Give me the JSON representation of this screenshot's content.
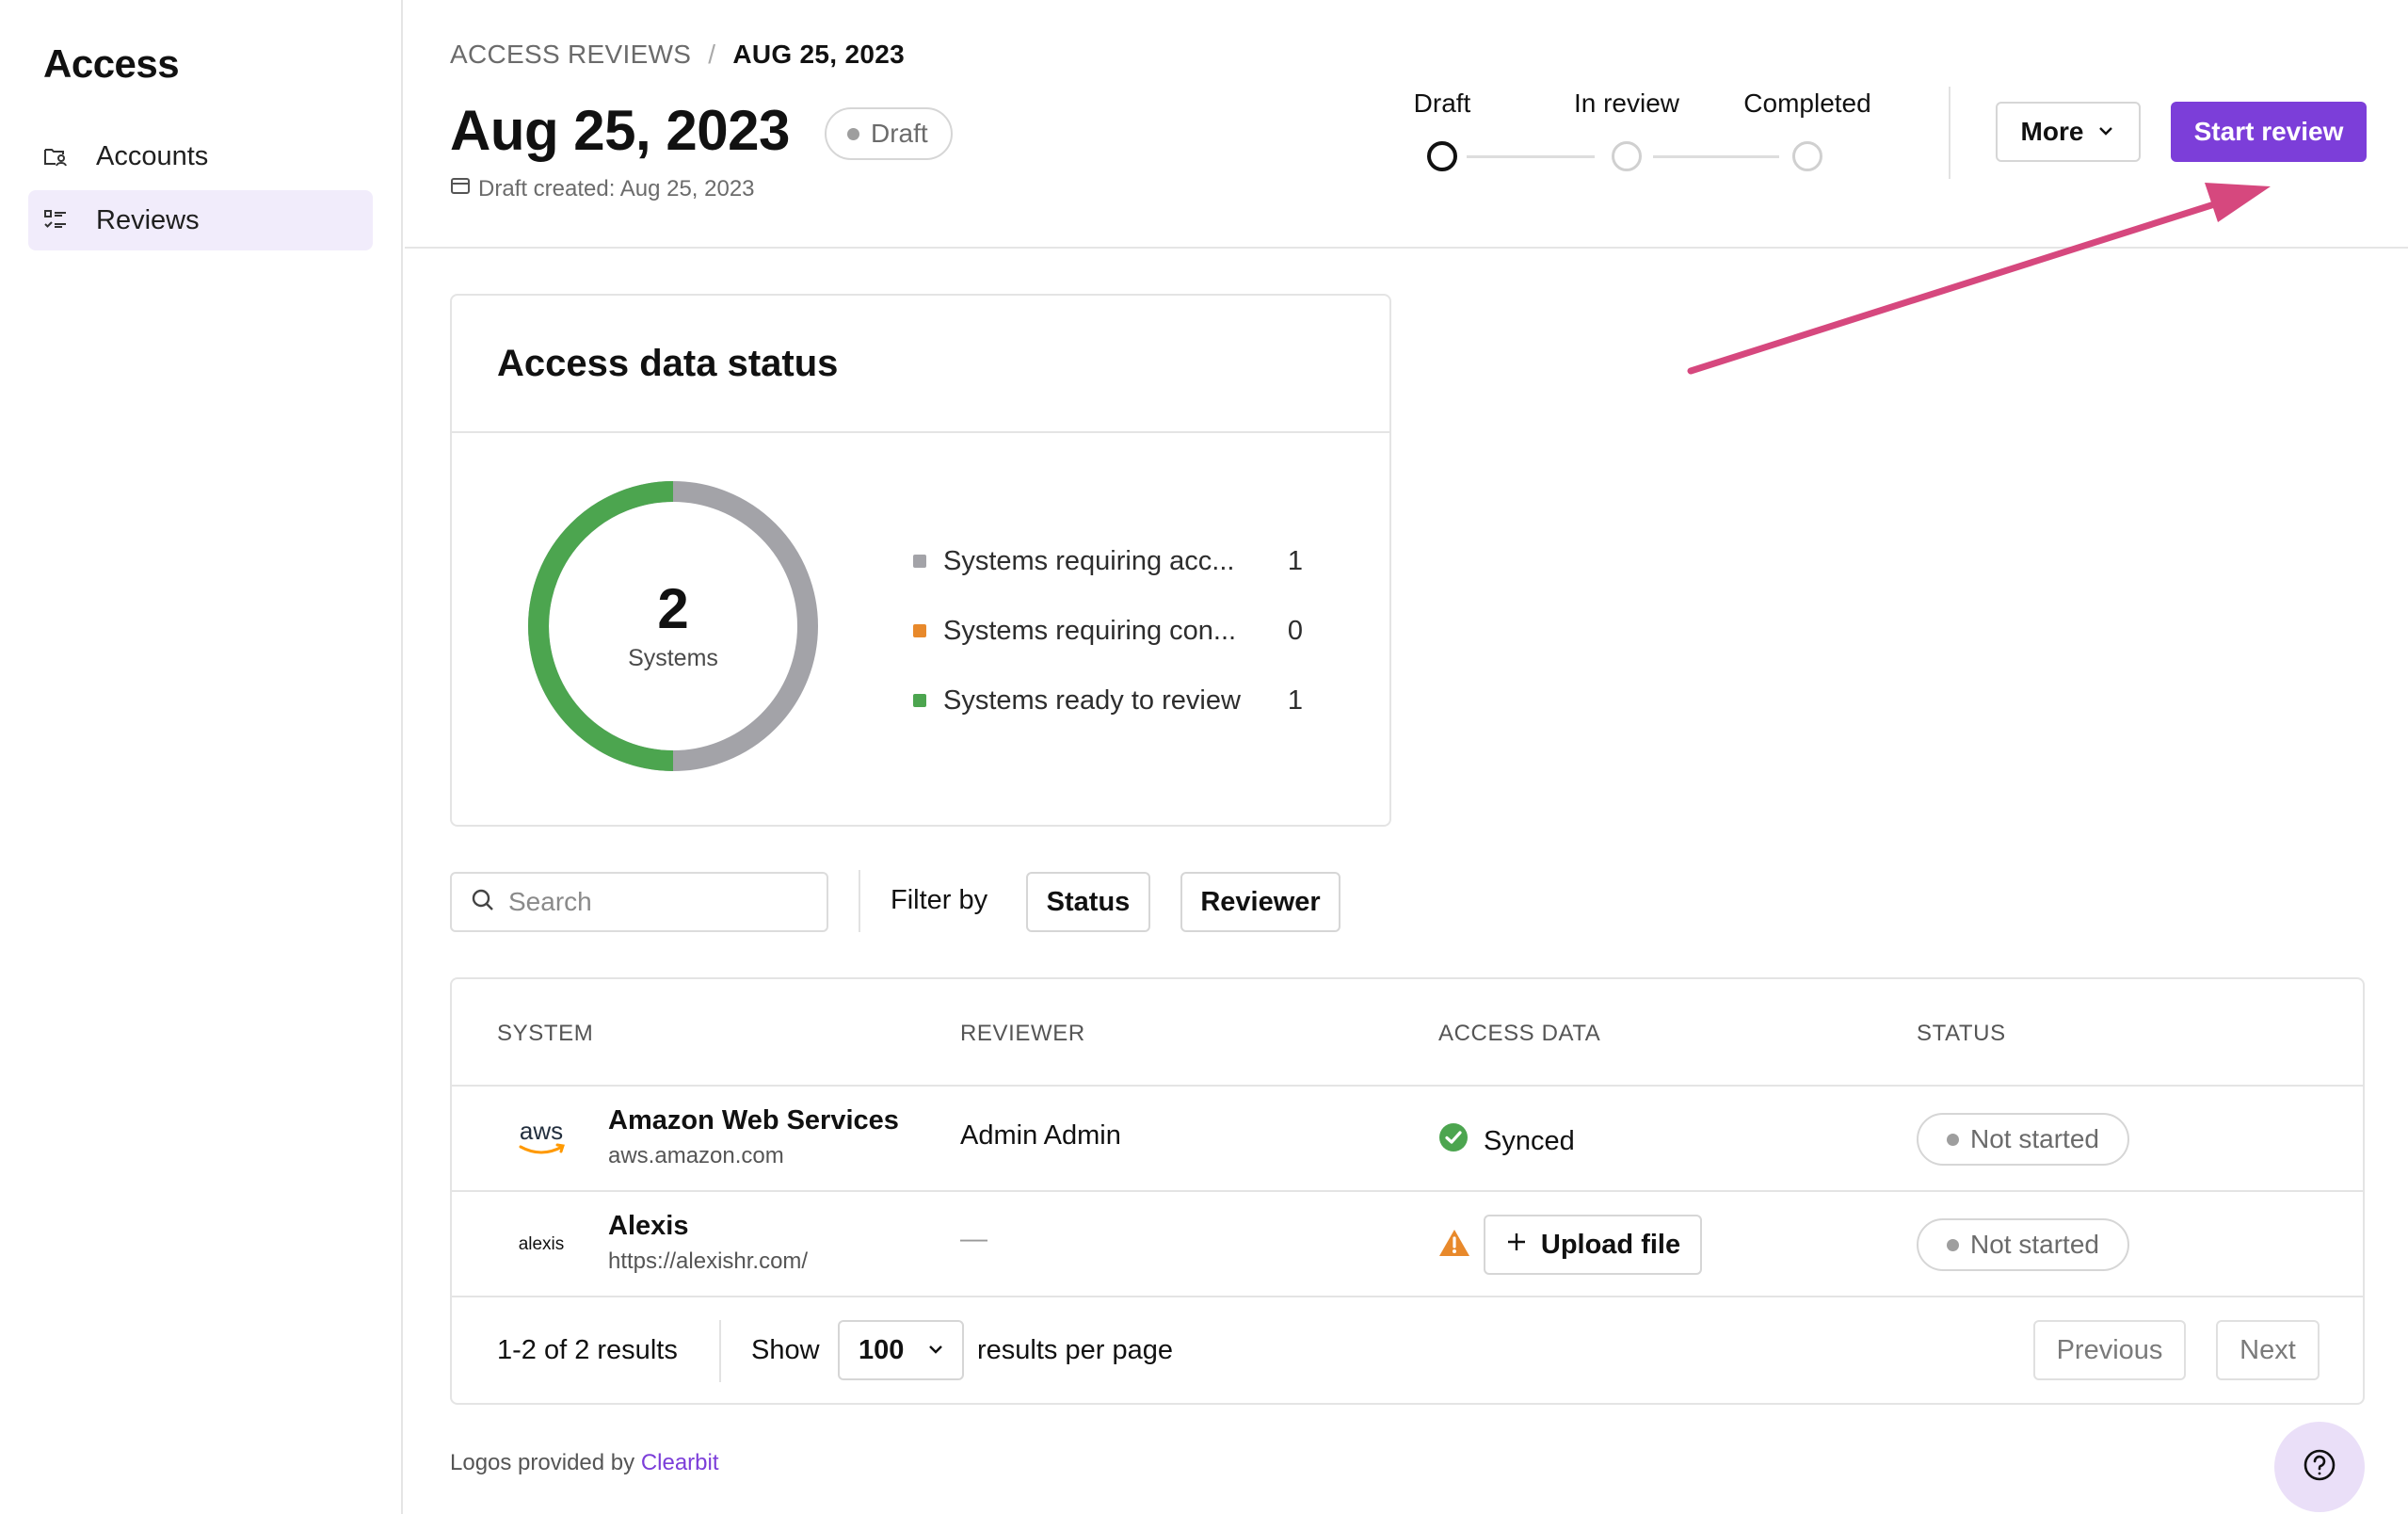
{
  "sidebar": {
    "app_title": "Access",
    "items": [
      {
        "label": "Accounts",
        "icon": "folder-user-icon",
        "active": false
      },
      {
        "label": "Reviews",
        "icon": "checklist-icon",
        "active": true
      }
    ]
  },
  "header": {
    "breadcrumb": {
      "parent": "ACCESS REVIEWS",
      "separator": "/",
      "current": "AUG 25, 2023"
    },
    "title": "Aug 25, 2023",
    "badge": "Draft",
    "draft_created": "Draft created: Aug 25, 2023",
    "stepper": {
      "steps": [
        {
          "label": "Draft",
          "state": "current"
        },
        {
          "label": "In review",
          "state": "todo"
        },
        {
          "label": "Completed",
          "state": "todo"
        }
      ]
    },
    "more_label": "More",
    "start_label": "Start review"
  },
  "status_card": {
    "title": "Access data status",
    "total": "2",
    "total_label": "Systems",
    "legend": [
      {
        "label": "Systems requiring acc...",
        "value": "1",
        "color": "#a3a3a8"
      },
      {
        "label": "Systems requiring con...",
        "value": "0",
        "color": "#e8892b"
      },
      {
        "label": "Systems ready to review",
        "value": "1",
        "color": "#4ca54f"
      }
    ]
  },
  "filters": {
    "search_placeholder": "Search",
    "filter_by": "Filter by",
    "status_label": "Status",
    "reviewer_label": "Reviewer"
  },
  "table": {
    "headers": {
      "system": "SYSTEM",
      "reviewer": "REVIEWER",
      "access_data": "ACCESS DATA",
      "status": "STATUS"
    },
    "rows": [
      {
        "logo": "aws",
        "name": "Amazon Web Services",
        "url": "aws.amazon.com",
        "reviewer": "Admin Admin",
        "access_data": "Synced",
        "status": "Not started"
      },
      {
        "logo": "alexis",
        "name": "Alexis",
        "url": "https://alexishr.com/",
        "reviewer": "—",
        "access_data": "Upload file",
        "status": "Not started"
      }
    ],
    "pagination": {
      "results": "1-2 of 2 results",
      "show": "Show",
      "per_page": "100",
      "per_page_suffix": "results per page",
      "previous": "Previous",
      "next": "Next"
    }
  },
  "footer": {
    "note": "Logos provided by",
    "link": "Clearbit"
  },
  "colors": {
    "accent": "#7c3ed9",
    "success": "#4ca54f",
    "warning": "#e8892b",
    "neutral": "#a3a3a8",
    "annotation": "#d6487e"
  }
}
